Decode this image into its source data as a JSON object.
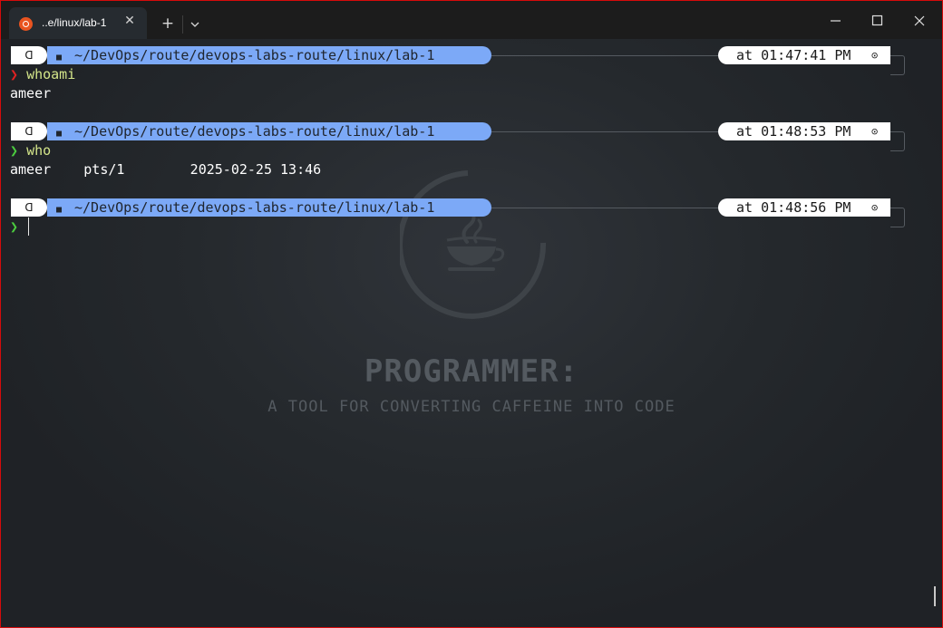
{
  "window": {
    "tab_title": "..e/linux/lab-1",
    "tab_close_glyph": "✕",
    "new_tab_glyph": "+",
    "icons": {
      "tab": "ubuntu-icon",
      "dropdown": "chevron-down-icon",
      "minimize": "minimize-icon",
      "maximize": "maximize-icon",
      "close": "close-icon"
    }
  },
  "prompt": {
    "user_glyph": "ᗡ",
    "folder_glyph": "■",
    "clock_glyph": "⊙",
    "path": "~/DevOps/route/devops-labs-route/linux/lab-1",
    "chevron": "❯"
  },
  "blocks": [
    {
      "time": "at 01:47:41 PM",
      "command": "whoami",
      "status": "error",
      "output": "ameer"
    },
    {
      "time": "at 01:48:53 PM",
      "command": "who",
      "status": "success",
      "output": "ameer    pts/1        2025-02-25 13:46"
    },
    {
      "time": "at 01:48:56 PM",
      "command": "",
      "status": "success",
      "output": ""
    }
  ],
  "watermark": {
    "title": "PROGRAMMER:",
    "subtitle": "A TOOL FOR CONVERTING CAFFEINE INTO CODE",
    "icon": "coffee-cup-icon"
  },
  "colors": {
    "path_pill": "#7ca9f7",
    "error_chevron": "#e02222",
    "success_chevron": "#4bcc3f",
    "command_text": "#d4e68a",
    "frame_border": "#d60b0b"
  }
}
